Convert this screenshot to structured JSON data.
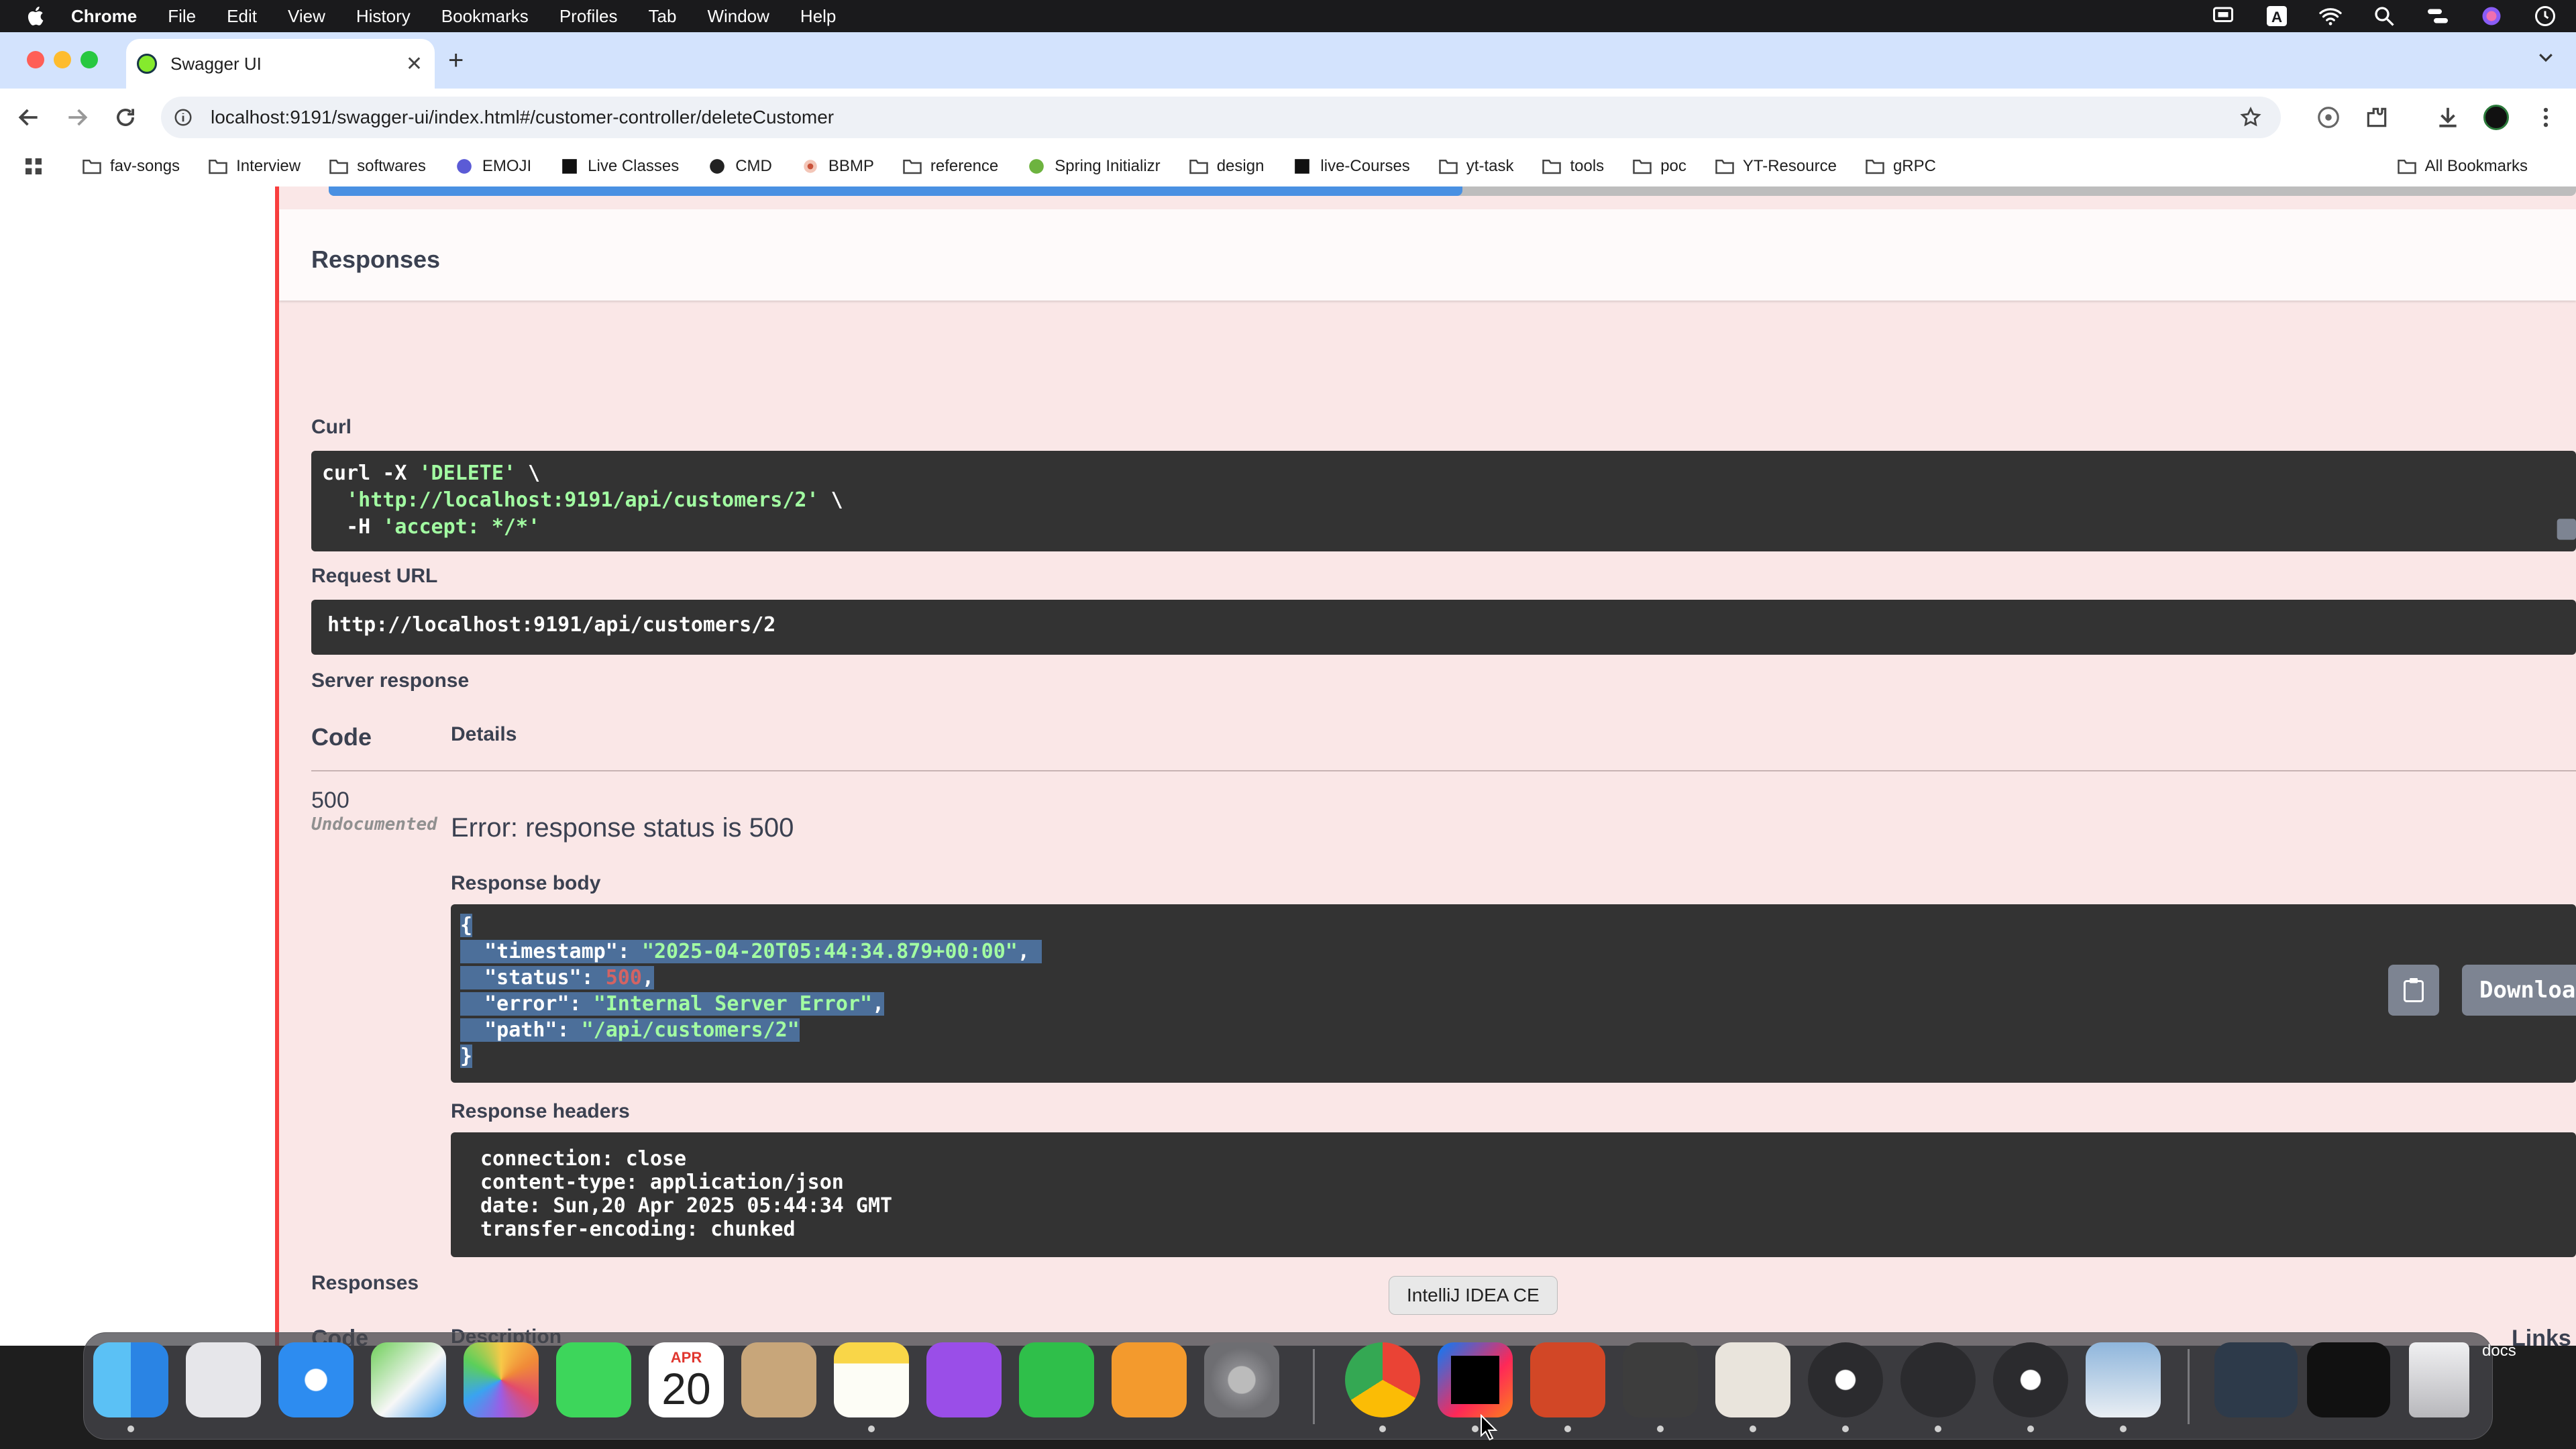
{
  "menubar": {
    "items": [
      "Chrome",
      "File",
      "Edit",
      "View",
      "History",
      "Bookmarks",
      "Profiles",
      "Tab",
      "Window",
      "Help"
    ]
  },
  "browser": {
    "tab_title": "Swagger UI",
    "url": "localhost:9191/swagger-ui/index.html#/customer-controller/deleteCustomer",
    "bookmarks": [
      {
        "label": "fav-songs",
        "icon": "folder-icon"
      },
      {
        "label": "Interview",
        "icon": "folder-icon"
      },
      {
        "label": "softwares",
        "icon": "folder-icon"
      },
      {
        "label": "EMOJI",
        "icon": "emoji-icon"
      },
      {
        "label": "Live Classes",
        "icon": "live-icon"
      },
      {
        "label": "CMD",
        "icon": "github-icon"
      },
      {
        "label": "BBMP",
        "icon": "bbmp-icon"
      },
      {
        "label": "reference",
        "icon": "folder-icon"
      },
      {
        "label": "Spring Initializr",
        "icon": "spring-icon"
      },
      {
        "label": "design",
        "icon": "folder-icon"
      },
      {
        "label": "live-Courses",
        "icon": "live-icon"
      },
      {
        "label": "yt-task",
        "icon": "folder-icon"
      },
      {
        "label": "tools",
        "icon": "folder-icon"
      },
      {
        "label": "poc",
        "icon": "folder-icon"
      },
      {
        "label": "YT-Resource",
        "icon": "folder-icon"
      },
      {
        "label": "gRPC",
        "icon": "folder-icon"
      }
    ],
    "all_bookmarks": "All Bookmarks"
  },
  "swagger": {
    "responses_title": "Responses",
    "curl_label": "Curl",
    "curl_lines": {
      "l1a": "curl -X ",
      "l1b": "'DELETE'",
      "l1c": " \\",
      "l2a": "  ",
      "l2b": "'http://localhost:9191/api/customers/2'",
      "l2c": " \\",
      "l3a": "  -H ",
      "l3b": "'accept: */*'"
    },
    "request_url_label": "Request URL",
    "request_url": "http://localhost:9191/api/customers/2",
    "server_response_label": "Server response",
    "col_code": "Code",
    "col_details": "Details",
    "status_code": "500",
    "undocumented": "Undocumented",
    "error_text": "Error: response status is 500",
    "response_body_label": "Response body",
    "body": {
      "open": "{",
      "k_timestamp": "  \"timestamp\": ",
      "v_timestamp": "\"2025-04-20T05:44:34.879+00:00\"",
      "k_status": "  \"status\": ",
      "v_status": "500",
      "k_error": "  \"error\": ",
      "v_error": "\"Internal Server Error\"",
      "k_path": "  \"path\": ",
      "v_path": "\"/api/customers/2\"",
      "comma": ",",
      "close": "}"
    },
    "download_label": "Download",
    "response_headers_label": "Response headers",
    "headers": [
      "connection: close",
      "content-type: application/json",
      "date: Sun,20 Apr 2025 05:44:34 GMT",
      "transfer-encoding: chunked"
    ],
    "responses_label2": "Responses",
    "col_code2": "Code",
    "col_description": "Description",
    "col_links": "Links"
  },
  "dock": {
    "tooltip": "IntelliJ IDEA CE",
    "calendar_month": "APR",
    "calendar_day": "20",
    "docs_label": "docs",
    "apps": [
      "finder-icon",
      "launchpad-icon",
      "safari-icon",
      "maps-icon",
      "photos-icon",
      "facetime-icon",
      "calendar-icon",
      "contacts-icon",
      "notes-icon",
      "podcasts-icon",
      "numbers-icon",
      "pages-icon",
      "settings-icon",
      "chrome-icon",
      "intellij-icon",
      "powerpoint-icon",
      "sublime-icon",
      "db-icon",
      "obs-icon",
      "notion-icon",
      "obs2-icon",
      "preview-icon",
      "screen1-icon",
      "screen2-icon",
      "trash-icon"
    ]
  }
}
